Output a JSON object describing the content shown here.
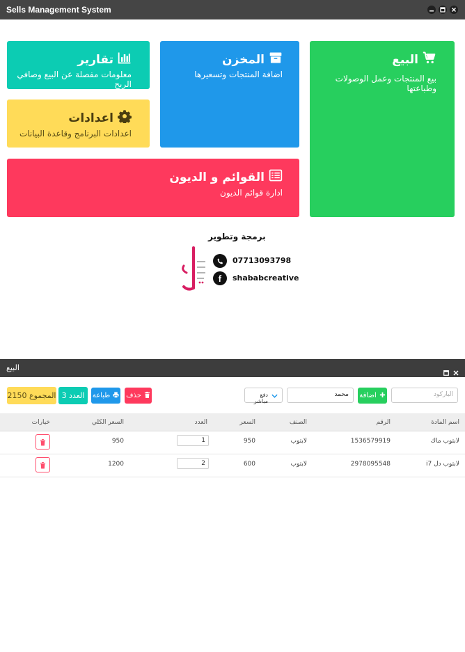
{
  "window": {
    "title": "Sells Management System"
  },
  "colors": {
    "green": "#27cf5e",
    "blue": "#1f98ea",
    "teal": "#0cccb3",
    "yellow": "#ffdb58",
    "red": "#fe395d",
    "dark": "#454545"
  },
  "tiles": {
    "sell": {
      "title": "البيع",
      "subtitle": "بيع المنتجات وعمل الوصولات وطباعتها",
      "icon": "cart-icon"
    },
    "store": {
      "title": "المخزن",
      "subtitle": "اضافة المنتجات وتسعيرها",
      "icon": "box-icon"
    },
    "reports": {
      "title": "تقارير",
      "subtitle": "معلومات مفصلة عن البيع وصافي الربح",
      "icon": "bar-chart-icon"
    },
    "settings": {
      "title": "اعدادات",
      "subtitle": "اعدادات البرنامج وقاعدة البيانات",
      "icon": "gear-icon"
    },
    "debts": {
      "title": "القوائم و الديون",
      "subtitle": "ادارة قوائم الديون",
      "icon": "list-icon"
    }
  },
  "credit": {
    "heading": "برمجة وتطوير",
    "phone": "07713093798",
    "facebook": "shababcreative",
    "logo_text": "شباب"
  },
  "panel": {
    "title": "البيع",
    "total_label": "المجموع 2150",
    "count_label": "العدد 3",
    "print_label": "طباعة",
    "delete_label": "حذف",
    "payment_select": "دفع مباشر",
    "customer_value": "محمد",
    "add_label": "اضافة",
    "barcode_placeholder": "الباركود"
  },
  "table": {
    "headers": {
      "name": "اسم المادة",
      "number": "الرقم",
      "category": "الصنف",
      "price": "السعر",
      "quantity": "العدد",
      "total": "السعر الكلي",
      "options": "خيارات"
    },
    "rows": [
      {
        "name": "لابتوب ماك",
        "number": "1536579919",
        "category": "لابتوب",
        "price": "950",
        "quantity": "1",
        "total": "950"
      },
      {
        "name": "لابتوب دل i7",
        "number": "2978095548",
        "category": "لابتوب",
        "price": "600",
        "quantity": "2",
        "total": "1200"
      }
    ]
  }
}
